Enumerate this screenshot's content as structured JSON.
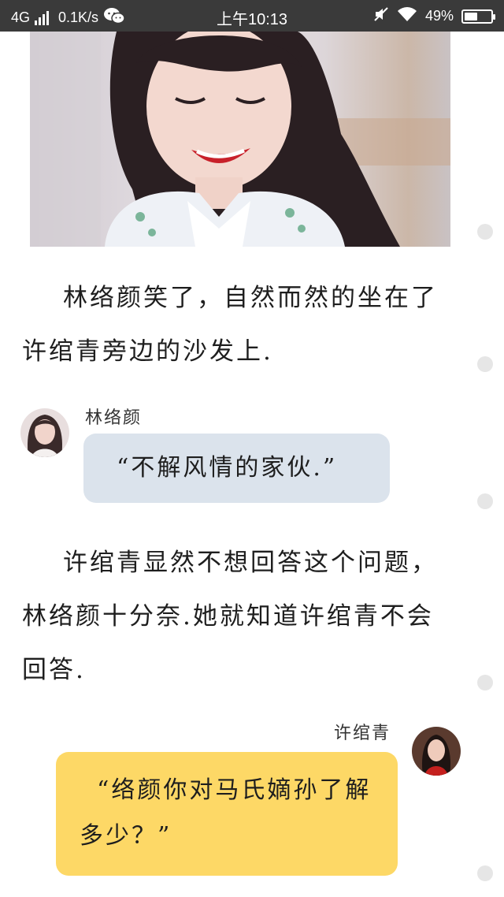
{
  "status_bar": {
    "network": "4G",
    "speed": "0.1K/s",
    "time": "上午10:13",
    "battery_percent": "49%",
    "battery_level": 0.49,
    "icons": [
      "signal-icon",
      "wechat-icon",
      "mute-icon",
      "wifi-icon",
      "battery-icon"
    ]
  },
  "story": {
    "paragraph_1": "林络颜笑了，自然而然的坐在了许绾青旁边的沙发上.",
    "paragraph_2": "许绾青显然不想回答这个问题，林络颜十分奈.她就知道许绾青不会回答."
  },
  "chat": [
    {
      "speaker": "林络颜",
      "text": "“不解风情的家伙.”",
      "side": "left",
      "bubble_color": "#dbe3ec"
    },
    {
      "speaker": "许绾青",
      "text": "“络颜你对马氏嫡孙了解多少？”",
      "side": "right",
      "bubble_color": "#fdd866"
    }
  ]
}
